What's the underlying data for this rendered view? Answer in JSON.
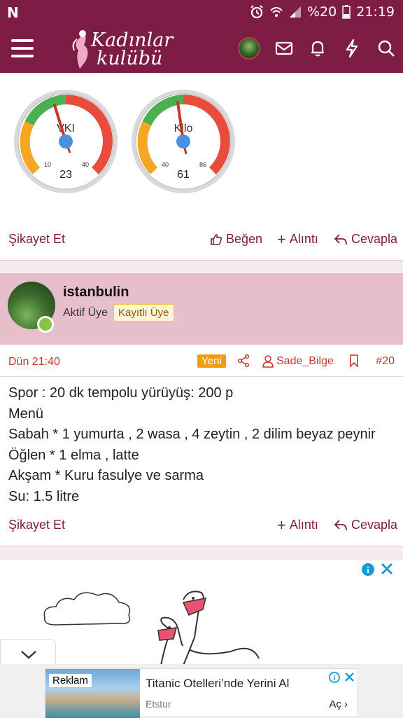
{
  "status_bar": {
    "app_letter": "N",
    "battery": "%20",
    "time": "21:19"
  },
  "header": {
    "logo_line1": "Kadınlar",
    "logo_line2": "kulübü"
  },
  "gauges": [
    {
      "label": "VKI",
      "value": "23",
      "min_tick": "10",
      "max_tick": "40"
    },
    {
      "label": "Kilo",
      "value": "61",
      "min_tick": "40",
      "max_tick": "86"
    }
  ],
  "post1_actions": {
    "report": "Şikayet Et",
    "like": "Beğen",
    "quote": "Alıntı",
    "reply": "Cevapla"
  },
  "post2": {
    "username": "istanbulin",
    "role": "Aktif Üye",
    "badge": "Kayıtlı Üye",
    "date": "Dün 21:40",
    "new_label": "Yeni",
    "mention_user": "Sade_Bilge",
    "post_number": "#20",
    "lines": [
      "Spor : 20 dk tempolu yürüyüş: 200 p",
      "Menü",
      "Sabah * 1 yumurta , 2 wasa , 4 zeytin , 2 dilim beyaz peynir",
      "Öğlen * 1 elma , latte",
      "Akşam * Kuru fasulye ve sarma",
      "Su: 1.5 litre"
    ],
    "actions": {
      "report": "Şikayet Et",
      "quote": "Alıntı",
      "reply": "Cevapla"
    }
  },
  "ad_banner": {
    "tag": "Reklam",
    "title": "Titanic Otelleri’nde Yerini Al",
    "source": "Etstur",
    "cta": "Aç"
  },
  "colors": {
    "brand": "#7d1c45",
    "accent_red": "#c0392b",
    "badge_orange": "#f39c12"
  }
}
